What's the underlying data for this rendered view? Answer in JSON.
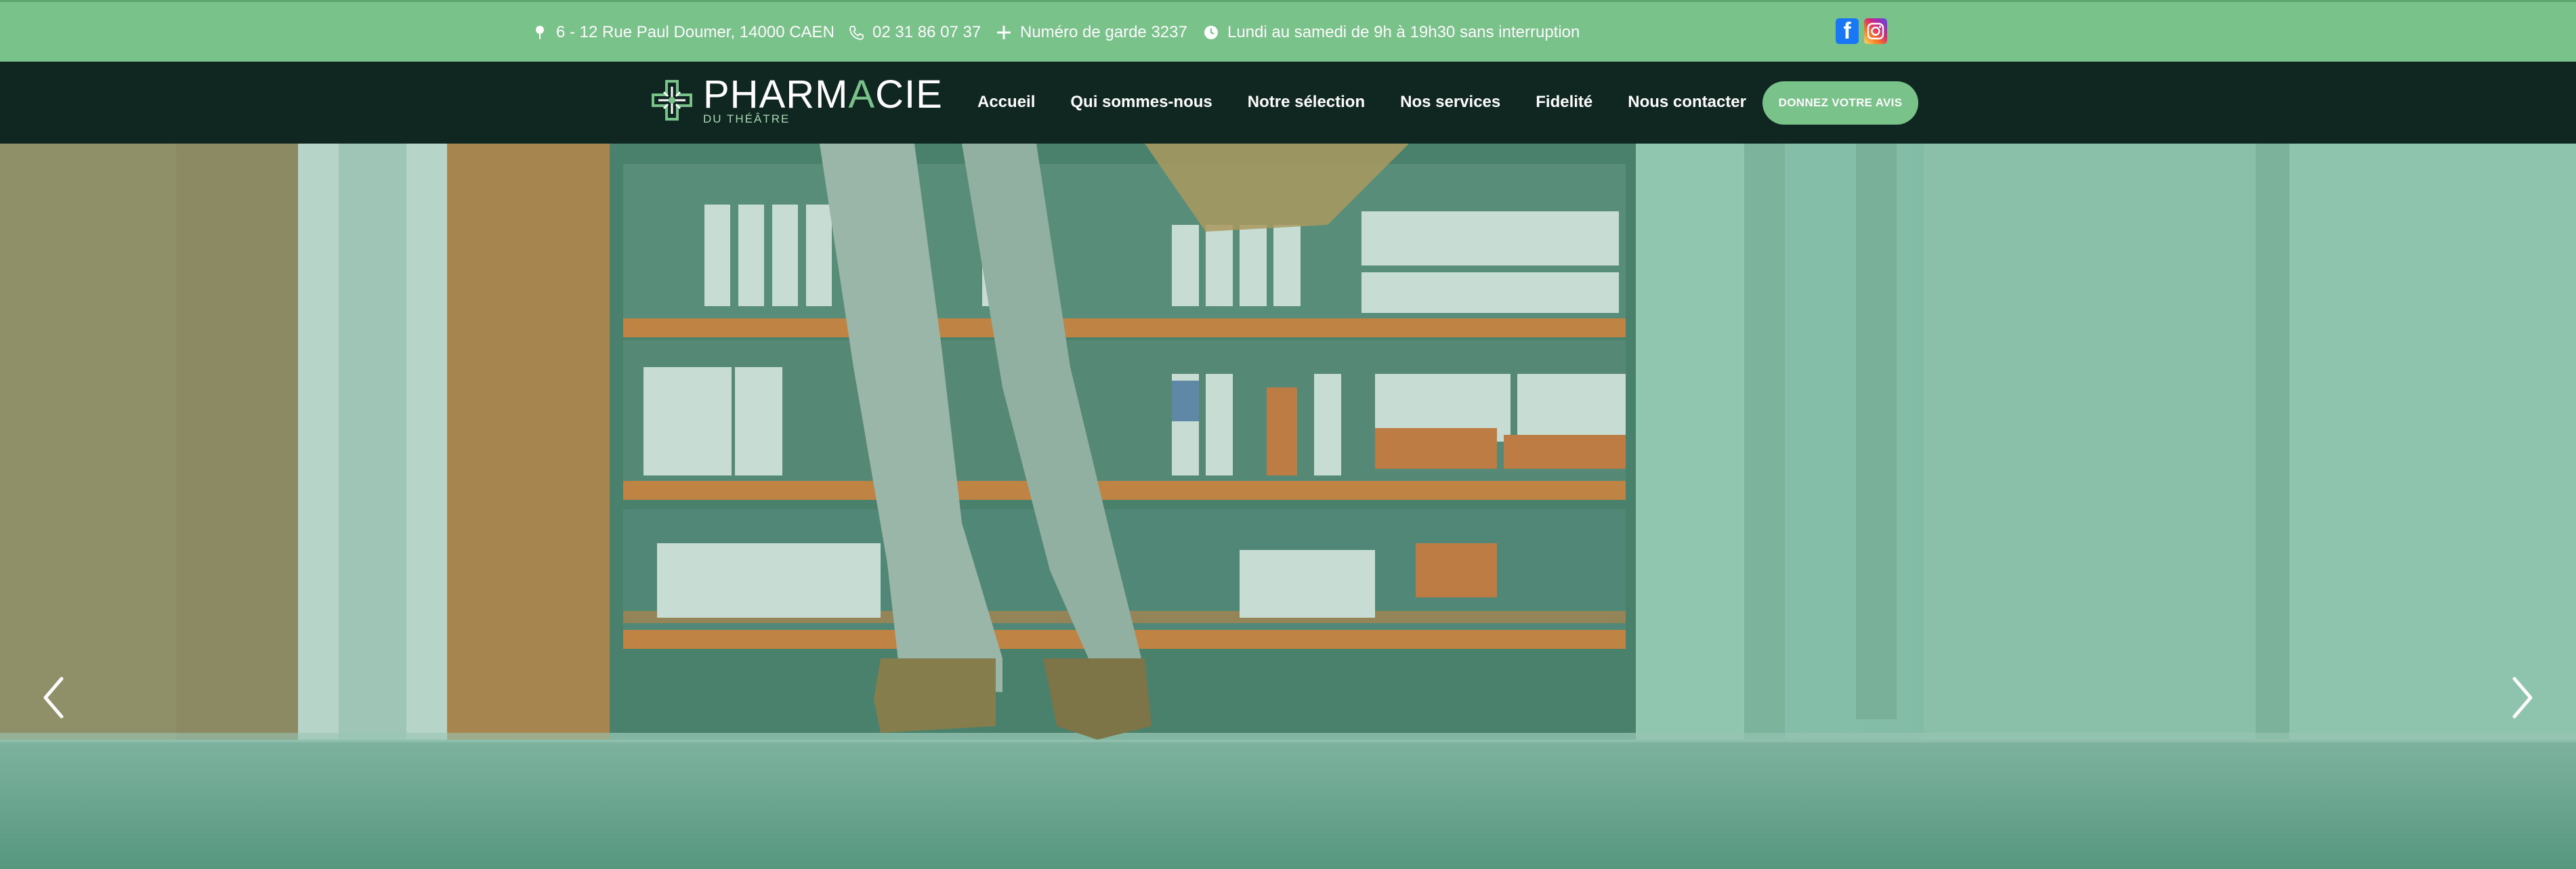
{
  "topbar": {
    "address": "6 - 12 Rue Paul Doumer, 14000 CAEN",
    "phone": "02 31 86 07 37",
    "garde": "Numéro de garde 3237",
    "hours": "Lundi au samedi de 9h à 19h30 sans interruption",
    "social": [
      {
        "name": "facebook-icon"
      },
      {
        "name": "instagram-icon"
      }
    ]
  },
  "brand": {
    "name_part1": "PHARM",
    "name_accent": "A",
    "name_part2": "CIE",
    "subtitle": "DU THÉÂTRE"
  },
  "nav": {
    "items": [
      {
        "label": "Accueil"
      },
      {
        "label": "Qui sommes-nous"
      },
      {
        "label": "Notre sélection"
      },
      {
        "label": "Nos services"
      },
      {
        "label": "Fidelité"
      },
      {
        "label": "Nous contacter"
      }
    ],
    "cta_label": "DONNEZ VOTRE AVIS"
  },
  "colors": {
    "accent": "#79c38a",
    "navbar": "#102620",
    "hero_tint": "#3f8a6a"
  },
  "hero": {
    "prev_icon": "chevron-left-icon",
    "next_icon": "chevron-right-icon"
  }
}
